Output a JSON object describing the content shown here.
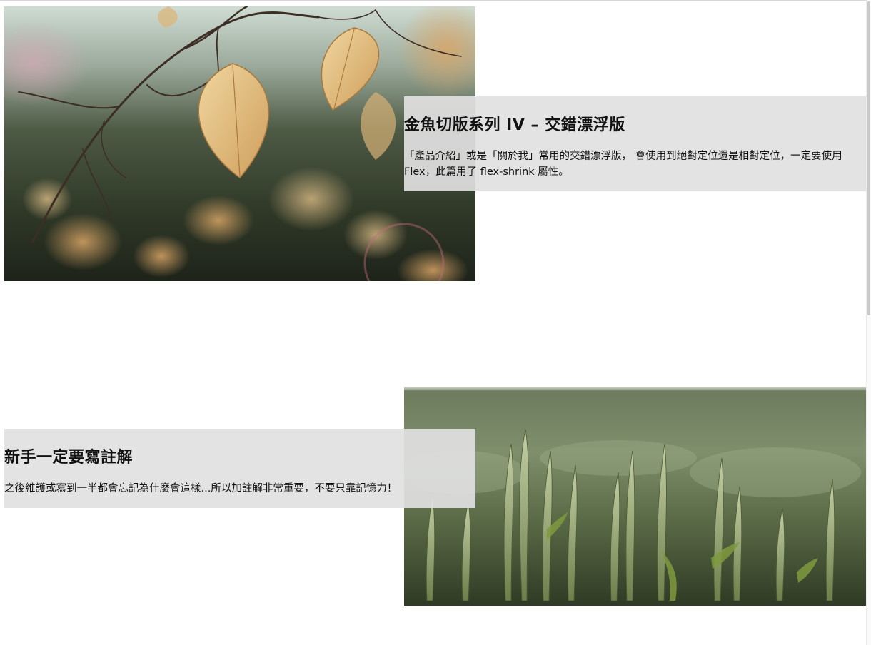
{
  "cards": [
    {
      "title": "金魚切版系列 IV – 交錯漂浮版",
      "description": "「產品介紹」或是「關於我」常用的交錯漂浮版， 會使用到絕對定位還是相對定位，一定要使用 Flex，此篇用了 flex-shrink 屬性。",
      "image": "autumn-leaves-photo"
    },
    {
      "title": "新手一定要寫註解",
      "description": "之後維護或寫到一半都會忘記為什麼會這樣...所以加註解非常重要，不要只靠記憶力！",
      "image": "wheat-field-photo"
    }
  ],
  "colors": {
    "caption_background": "#e1e1e1",
    "page_background": "#ffffff",
    "text": "#111111"
  }
}
